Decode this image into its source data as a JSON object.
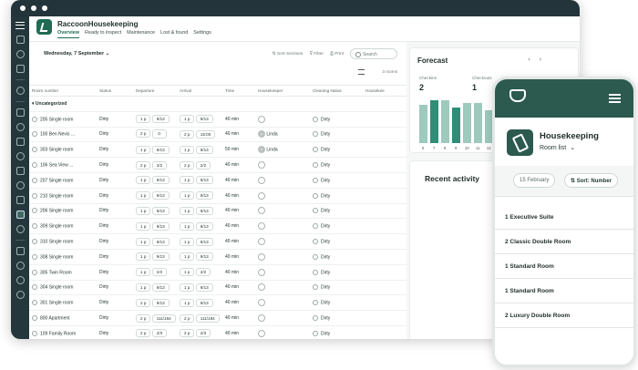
{
  "app": {
    "name": "RaccoonHousekeeping",
    "tabs": [
      "Overview",
      "Ready to inspect",
      "Maintenance",
      "Lost & found",
      "Settings"
    ]
  },
  "toolbar": {
    "date": "Wednesday, 7 September",
    "sort": "Sort Sections",
    "filter": "Filter",
    "print": "Print",
    "search_placeholder": "Search",
    "rooms_count": "3 rooms"
  },
  "table": {
    "columns": [
      "Room number",
      "Status",
      "Departure",
      "Arrival",
      "Time",
      "Housekeeper",
      "Cleaning status",
      "Housekee"
    ],
    "group": "Uncategorized",
    "rows": [
      {
        "room": "205 Single room",
        "status": "Dirty",
        "dep": "1 p",
        "dep2": "9/13",
        "arr": "1 p",
        "arr2": "9/13",
        "time": "40 min",
        "hk": "",
        "clean": "Dirty"
      },
      {
        "room": "100 Ben Nevis ...",
        "status": "Dirty",
        "dep": "2 p",
        "dep2": "⊙",
        "arr": "2 p",
        "arr2": "15:00",
        "time": "40 min",
        "hk": "Linda",
        "clean": "Dirty"
      },
      {
        "room": "303 Single room",
        "status": "Dirty",
        "dep": "1 p",
        "dep2": "9/13",
        "arr": "1 p",
        "arr2": "9/13",
        "time": "50 min",
        "hk": "Linda",
        "clean": "Dirty"
      },
      {
        "room": "106 Sea View ...",
        "status": "Dirty",
        "dep": "2 p",
        "dep2": "2/2",
        "arr": "2 p",
        "arr2": "2/2",
        "time": "40 min",
        "hk": "",
        "clean": "Dirty"
      },
      {
        "room": "207 Single room",
        "status": "Dirty",
        "dep": "1 p",
        "dep2": "9/13",
        "arr": "1 p",
        "arr2": "9/13",
        "time": "40 min",
        "hk": "",
        "clean": "Dirty"
      },
      {
        "room": "210 Single room",
        "status": "Dirty",
        "dep": "1 p",
        "dep2": "9/13",
        "arr": "1 p",
        "arr2": "9/13",
        "time": "40 min",
        "hk": "",
        "clean": "Dirty"
      },
      {
        "room": "206 Single room",
        "status": "Dirty",
        "dep": "1 p",
        "dep2": "9/13",
        "arr": "1 p",
        "arr2": "9/13",
        "time": "40 min",
        "hk": "",
        "clean": "Dirty"
      },
      {
        "room": "309 Single room",
        "status": "Dirty",
        "dep": "1 p",
        "dep2": "9/13",
        "arr": "1 p",
        "arr2": "9/13",
        "time": "40 min",
        "hk": "",
        "clean": "Dirty"
      },
      {
        "room": "310 Single room",
        "status": "Dirty",
        "dep": "1 p",
        "dep2": "9/13",
        "arr": "1 p",
        "arr2": "9/13",
        "time": "40 min",
        "hk": "",
        "clean": "Dirty"
      },
      {
        "room": "308 Single room",
        "status": "Dirty",
        "dep": "1 p",
        "dep2": "9/13",
        "arr": "1 p",
        "arr2": "9/13",
        "time": "40 min",
        "hk": "",
        "clean": "Dirty"
      },
      {
        "room": "305 Twin Room",
        "status": "Dirty",
        "dep": "1 p",
        "dep2": "2/2",
        "arr": "1 p",
        "arr2": "2/2",
        "time": "40 min",
        "hk": "",
        "clean": "Dirty"
      },
      {
        "room": "304 Single room",
        "status": "Dirty",
        "dep": "1 p",
        "dep2": "9/13",
        "arr": "1 p",
        "arr2": "9/13",
        "time": "40 min",
        "hk": "",
        "clean": "Dirty"
      },
      {
        "room": "301 Single room",
        "status": "Dirty",
        "dep": "2 p",
        "dep2": "9/13",
        "arr": "1 p",
        "arr2": "9/13",
        "time": "40 min",
        "hk": "",
        "clean": "Dirty"
      },
      {
        "room": "800 Apartment",
        "status": "Dirty",
        "dep": "2 p",
        "dep2": "111/184",
        "arr": "2 p",
        "arr2": "111/184",
        "time": "40 min",
        "hk": "",
        "clean": "Dirty"
      },
      {
        "room": "109 Family Room",
        "status": "Dirty",
        "dep": "2 p",
        "dep2": "2/3",
        "arr": "2 p",
        "arr2": "2/3",
        "time": "40 min",
        "hk": "",
        "clean": "Dirty"
      }
    ]
  },
  "forecast": {
    "title": "Forecast",
    "checkins_label": "Checkins",
    "checkins": "2",
    "checkouts_label": "Checkouts",
    "checkouts": "1"
  },
  "chart_data": {
    "type": "bar",
    "categories": [
      "6",
      "7",
      "8",
      "9",
      "10",
      "11",
      "12"
    ],
    "values": [
      30,
      34,
      34,
      28,
      32,
      32,
      26
    ],
    "highlight": [
      false,
      true,
      false,
      true,
      false,
      false,
      false
    ]
  },
  "recent": {
    "title": "Recent activity"
  },
  "phone": {
    "title": "Housekeeping",
    "subtitle": "Room list",
    "date_btn": "15 February",
    "sort_btn": "Sort: Number",
    "rooms": [
      "1 Executive Suite",
      "2 Classic Double Room",
      "1 Standard Room",
      "1 Standard Room",
      "2 Luxury Double Room"
    ]
  }
}
